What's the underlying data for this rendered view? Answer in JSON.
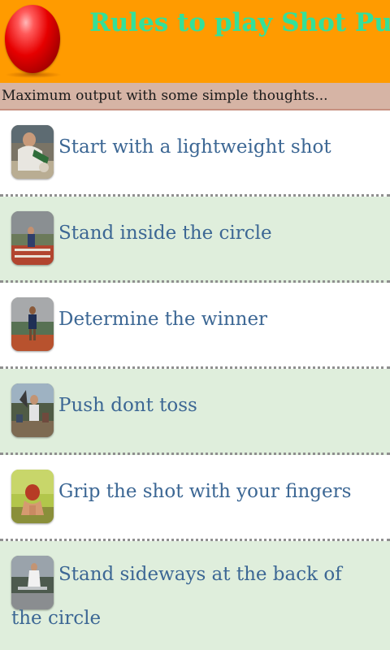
{
  "header": {
    "title": "Rules to play Shot Put",
    "logo": "red-ball-icon"
  },
  "subheader": {
    "text": "Maximum output with some simple thoughts..."
  },
  "items": [
    {
      "label": "Start with a lightweight shot",
      "thumb": "athlete-photo-thumbnail"
    },
    {
      "label": "Stand inside the circle",
      "thumb": "stadium-photo-thumbnail"
    },
    {
      "label": "Determine the winner",
      "thumb": "thrower-photo-thumbnail"
    },
    {
      "label": "Push dont toss",
      "thumb": "crowd-photo-thumbnail"
    },
    {
      "label": "Grip the shot with your fingers",
      "thumb": "grip-photo-thumbnail"
    },
    {
      "label": "Stand sideways at the back of the circle",
      "thumb": "stadium-thrower-photo-thumbnail"
    }
  ],
  "colors": {
    "header_bg": "#ff9b00",
    "title": "#33e09a",
    "subheader_bg": "#d6b4a5",
    "item_text": "#3c6794",
    "alt_row": "#dfeedc"
  }
}
